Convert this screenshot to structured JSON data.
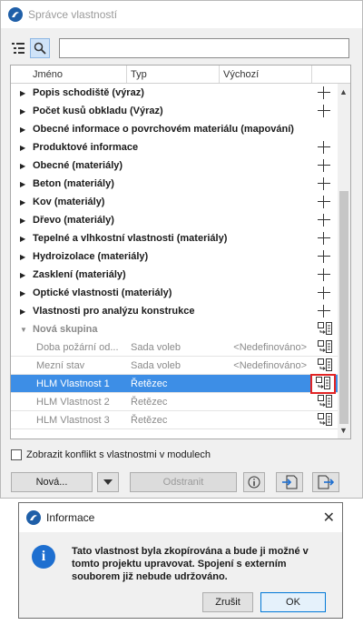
{
  "window": {
    "title": "Správce vlastností"
  },
  "search": {
    "value": "",
    "placeholder": ""
  },
  "columns": {
    "name": "Jméno",
    "type": "Typ",
    "default": "Výchozí"
  },
  "groups": [
    "Popis schodiště (výraz)",
    "Počet kusů obkladu (Výraz)",
    "Obecné informace o povrchovém materiálu (mapování)",
    "Produktové informace",
    "Obecné (materiály)",
    "Beton (materiály)",
    "Kov (materiály)",
    "Dřevo (materiály)",
    "Tepelné a vlhkostní vlastnosti (materiály)",
    "Hydroizolace (materiály)",
    "Zasklení (materiály)",
    "Optické vlastnosti (materiály)",
    "Vlastnosti pro analýzu konstrukce"
  ],
  "new_group": {
    "label": "Nová skupina"
  },
  "properties": [
    {
      "name": "Doba požární od...",
      "type": "Sada voleb",
      "default": "<Nedefinováno>"
    },
    {
      "name": "Mezní stav",
      "type": "Sada voleb",
      "default": "<Nedefinováno>"
    },
    {
      "name": "HLM Vlastnost 1",
      "type": "Řetězec",
      "default": ""
    },
    {
      "name": "HLM Vlastnost 2",
      "type": "Řetězec",
      "default": ""
    },
    {
      "name": "HLM Vlastnost 3",
      "type": "Řetězec",
      "default": ""
    }
  ],
  "checkbox": {
    "label": "Zobrazit konflikt s vlastnostmi v modulech"
  },
  "buttons": {
    "new": "Nová...",
    "remove": "Odstranit"
  },
  "dialog": {
    "title": "Informace",
    "message": "Tato vlastnost byla zkopírována a bude ji možné v tomto projektu upravovat. Spojení s externím souborem již nebude udržováno.",
    "cancel": "Zrušit",
    "ok": "OK"
  },
  "colors": {
    "selection": "#3d8ee6",
    "highlight": "#e22424",
    "info": "#1e6fd0"
  }
}
